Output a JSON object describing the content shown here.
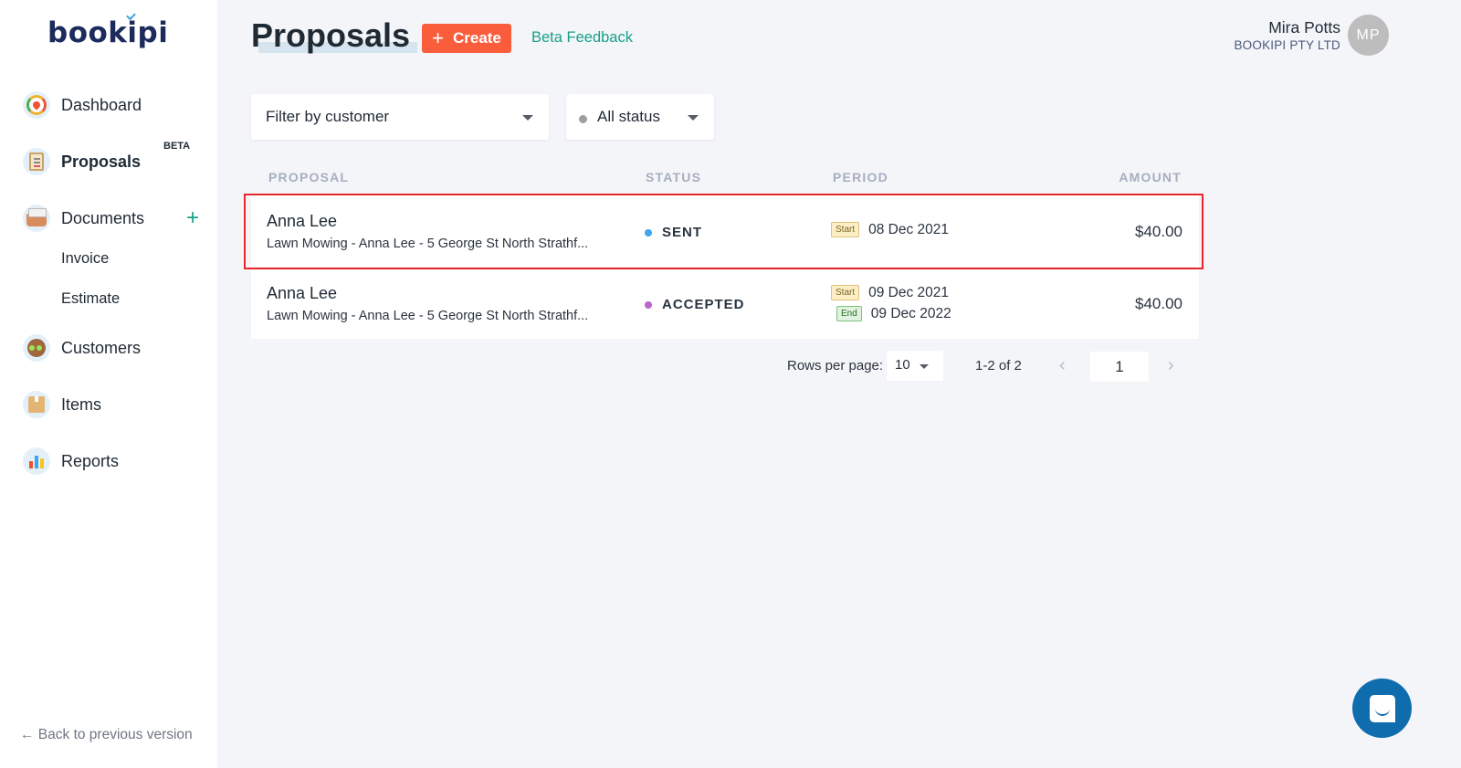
{
  "sidebar": {
    "logo": "bookipi",
    "items": [
      {
        "label": "Dashboard",
        "icon": "gauge-icon"
      },
      {
        "label": "Proposals",
        "icon": "clipboard-icon",
        "badge": "BETA",
        "active": true
      },
      {
        "label": "Documents",
        "icon": "tray-icon",
        "action": "+"
      },
      {
        "label": "Customers",
        "icon": "customer-avatar-icon"
      },
      {
        "label": "Items",
        "icon": "box-icon"
      },
      {
        "label": "Reports",
        "icon": "bar-chart-icon"
      }
    ],
    "sub_items": [
      "Invoice",
      "Estimate"
    ],
    "back_link": "← Back to previous version"
  },
  "header": {
    "title": "Proposals",
    "create_button": "Create",
    "create_icon": "+",
    "beta_feedback": "Beta Feedback",
    "user_name": "Mira Potts",
    "user_company": "BOOKIPI PTY LTD",
    "avatar_initials": "MP"
  },
  "filters": {
    "customer": "Filter by customer",
    "status": "All status"
  },
  "table": {
    "columns": [
      "PROPOSAL",
      "STATUS",
      "PERIOD",
      "AMOUNT"
    ],
    "rows": [
      {
        "name": "Anna Lee",
        "description": "Lawn Mowing - Anna Lee - 5 George St North Strathf...",
        "status": "SENT",
        "status_color": "#3fa3f0",
        "start_tag": "Start",
        "start_date": "08 Dec 2021",
        "amount": "$40.00",
        "highlighted": true
      },
      {
        "name": "Anna Lee",
        "description": "Lawn Mowing - Anna Lee - 5 George St North Strathf...",
        "status": "ACCEPTED",
        "status_color": "#b964c9",
        "start_tag": "Start",
        "start_date": "09 Dec 2021",
        "end_tag": "End",
        "end_date": "09 Dec 2022",
        "amount": "$40.00"
      }
    ]
  },
  "pagination": {
    "rows_per_page_label": "Rows per page:",
    "rows_per_page": "10",
    "range": "1-2 of 2",
    "current_page": "1",
    "prev": "‹",
    "next": "›"
  },
  "colors": {
    "accent": "#fa5d3c",
    "link": "#17a08a",
    "highlight_border": "#e8262b",
    "chat": "#0f6dad"
  }
}
